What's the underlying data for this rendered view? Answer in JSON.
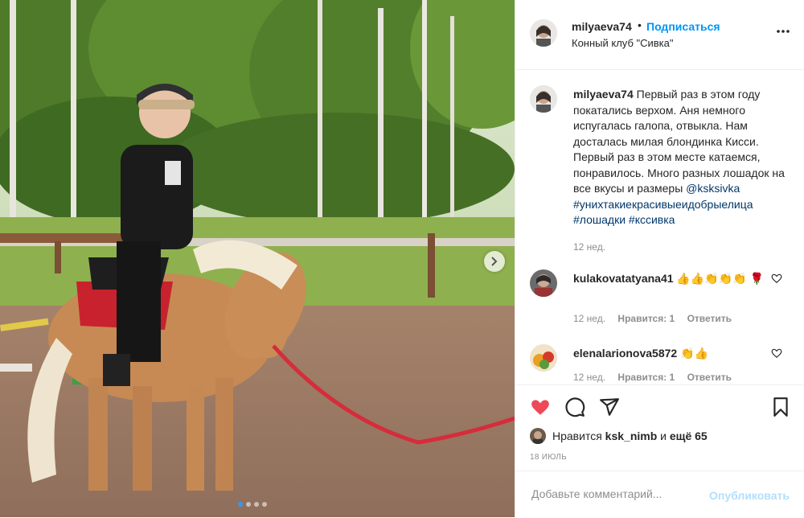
{
  "post": {
    "username": "milyaeva74",
    "separator": "•",
    "follow_label": "Подписаться",
    "location": "Конный клуб \"Сивка\"",
    "caption_text": "Первый раз в этом году покатались верхом. Аня немного испугалась галопа, отвыкла. Нам досталась милая блондинка Кисси. Первый раз в этом месте катаемся, понравилось. Много разных лошадок на все вкусы и размеры",
    "caption_tags": [
      "@ksksivka",
      "#унихтакиекрасивыеидобрыелица",
      "#лошадки",
      "#кссивка"
    ],
    "caption_time": "12 нед.",
    "carousel": {
      "slides": 4,
      "active_index": 0
    }
  },
  "comments": [
    {
      "username": "kulakovatatyana41",
      "text": "👍👍👏👏👏 🌹",
      "time": "12 нед.",
      "likes": "Нравится: 1",
      "reply": "Ответить"
    },
    {
      "username": "elenalarionova5872",
      "text": "👏👍",
      "time": "12 нед.",
      "likes": "Нравится: 1",
      "reply": "Ответить"
    }
  ],
  "actions": {
    "liked": true,
    "like_color": "#ed4956",
    "likes_prefix": "Нравится",
    "likes_user": "ksk_nimb",
    "likes_middle": "и",
    "likes_more": "ещё 65",
    "date": "18 ИЮЛЬ"
  },
  "add_comment": {
    "placeholder": "Добавьте комментарий...",
    "publish_label": "Опубликовать"
  },
  "icons": [
    "chevron-right-icon",
    "more-icon",
    "heart-icon",
    "comment-icon",
    "share-icon",
    "bookmark-icon",
    "small-heart-icon"
  ]
}
